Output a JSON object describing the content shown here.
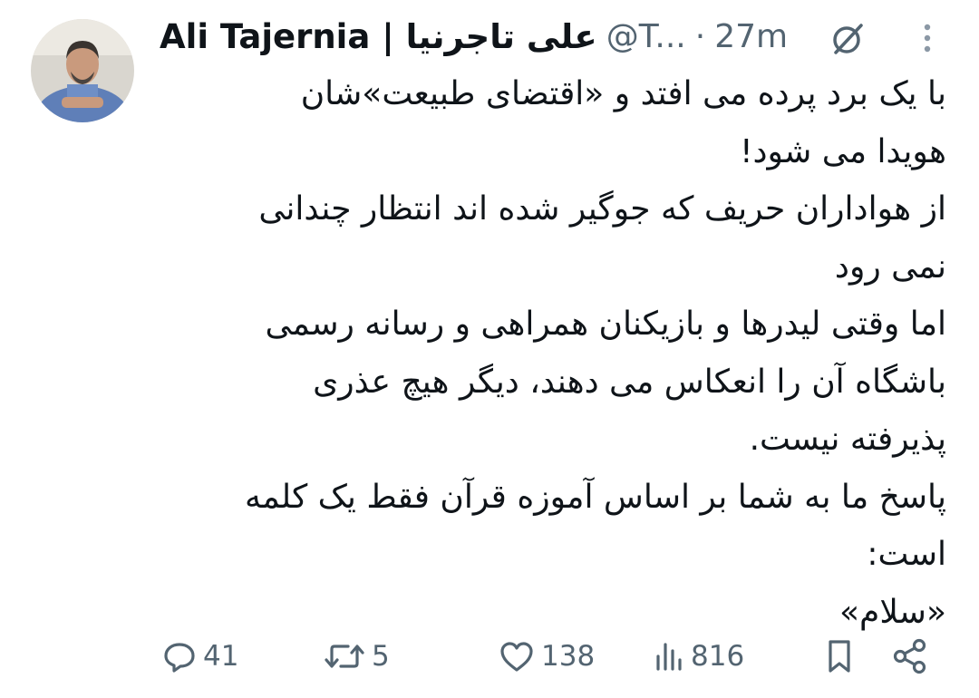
{
  "tweet": {
    "author_name": "Ali Tajernia | علی تاجرنیا",
    "handle": "@T...",
    "separator": "·",
    "time": "27m",
    "lines": [
      "با یک برد پرده می افتد و «اقتضای طبیعت»شان",
      "هویدا می شود!",
      "از هواداران حریف که جوگیر شده اند انتظار چندانی",
      "نمی رود",
      "اما وقتی لیدرها و بازیکنان همراهی و رسانه رسمی",
      "باشگاه آن را انعکاس می دهند، دیگر هیچ عذری",
      "پذیرفته نیست.",
      "پاسخ ما به شما بر اساس آموزه قرآن فقط یک کلمه",
      "است:",
      "«سلام»"
    ]
  },
  "actions": {
    "replies": "41",
    "retweets": "5",
    "likes": "138",
    "views": "816"
  },
  "icons": {
    "reply": "speech-bubble-icon",
    "retweet": "retweet-arrows-icon",
    "like": "heart-icon",
    "views": "bar-chart-icon",
    "bookmark": "bookmark-icon",
    "share": "share-nodes-icon",
    "grok": "grok-slash-circle-icon",
    "more": "vertical-dots-icon"
  },
  "colors": {
    "text": "#0f1419",
    "secondary": "#536471"
  }
}
